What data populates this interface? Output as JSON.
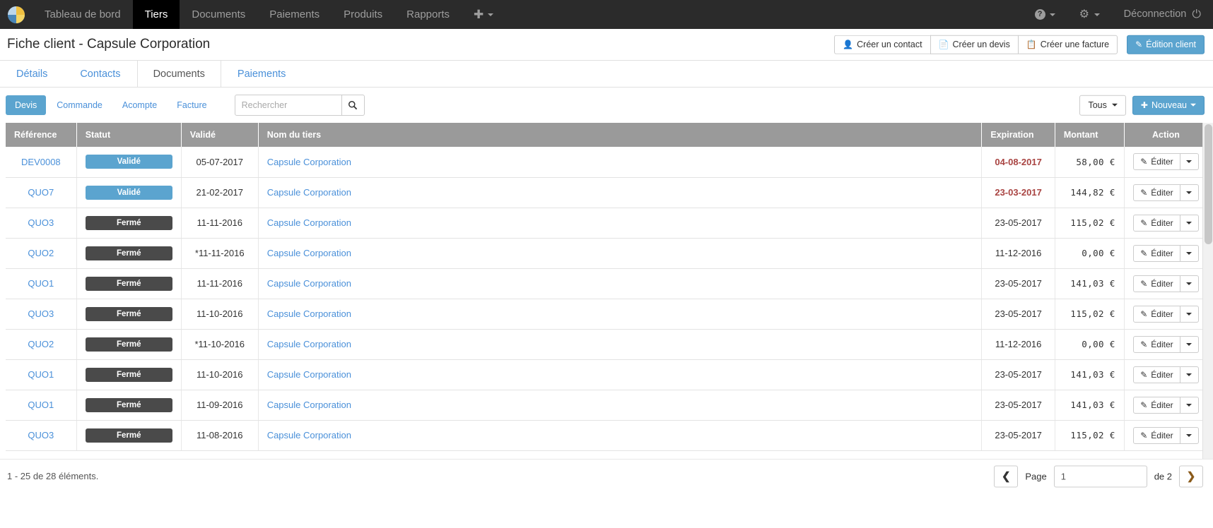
{
  "navbar": {
    "logo_icon": "pie-chart-logo",
    "items": [
      {
        "label": "Tableau de bord",
        "active": false
      },
      {
        "label": "Tiers",
        "active": true
      },
      {
        "label": "Documents",
        "active": false
      },
      {
        "label": "Paiements",
        "active": false
      },
      {
        "label": "Produits",
        "active": false
      },
      {
        "label": "Rapports",
        "active": false
      }
    ],
    "add_icon": "plus-icon",
    "help_icon": "question-circle-icon",
    "settings_icon": "gear-icon",
    "logout_label": "Déconnection",
    "power_icon": "power-icon"
  },
  "header": {
    "title": "Fiche client - Capsule Corporation",
    "actions": [
      {
        "label": "Créer un contact",
        "icon": "user-icon"
      },
      {
        "label": "Créer un devis",
        "icon": "file-icon"
      },
      {
        "label": "Créer une facture",
        "icon": "invoice-icon"
      }
    ],
    "primary_action": {
      "label": "Édition client",
      "icon": "pencil-square-icon",
      "color": "#5ba4cf"
    }
  },
  "tabs": [
    {
      "label": "Détails",
      "active": false
    },
    {
      "label": "Contacts",
      "active": false
    },
    {
      "label": "Documents",
      "active": true
    },
    {
      "label": "Paiements",
      "active": false
    }
  ],
  "filterbar": {
    "pills": [
      {
        "label": "Devis",
        "active": true
      },
      {
        "label": "Commande",
        "active": false
      },
      {
        "label": "Acompte",
        "active": false
      },
      {
        "label": "Facture",
        "active": false
      }
    ],
    "search": {
      "value": "",
      "placeholder": "Rechercher",
      "icon": "search-icon"
    },
    "filter_dropdown": {
      "label": "Tous",
      "icon": "chevron-down-icon"
    },
    "new_button": {
      "label": "Nouveau",
      "icon": "plus-icon",
      "color": "#5ba4cf"
    }
  },
  "table": {
    "columns": [
      "Référence",
      "Statut",
      "Validé",
      "Nom du tiers",
      "Expiration",
      "Montant",
      "Action"
    ],
    "action_label": "Éditer",
    "action_icon": "pencil-icon",
    "rows": [
      {
        "ref": "DEV0008",
        "statut": "Validé",
        "statut_kind": "valide",
        "valide": "05-07-2017",
        "nom": "Capsule Corporation",
        "expiration": "04-08-2017",
        "expiration_late": true,
        "montant": "58,00 €"
      },
      {
        "ref": "QUO7",
        "statut": "Validé",
        "statut_kind": "valide",
        "valide": "21-02-2017",
        "nom": "Capsule Corporation",
        "expiration": "23-03-2017",
        "expiration_late": true,
        "montant": "144,82 €"
      },
      {
        "ref": "QUO3",
        "statut": "Fermé",
        "statut_kind": "ferme",
        "valide": "11-11-2016",
        "nom": "Capsule Corporation",
        "expiration": "23-05-2017",
        "expiration_late": false,
        "montant": "115,02 €"
      },
      {
        "ref": "QUO2",
        "statut": "Fermé",
        "statut_kind": "ferme",
        "valide": "*11-11-2016",
        "nom": "Capsule Corporation",
        "expiration": "11-12-2016",
        "expiration_late": false,
        "montant": "0,00 €"
      },
      {
        "ref": "QUO1",
        "statut": "Fermé",
        "statut_kind": "ferme",
        "valide": "11-11-2016",
        "nom": "Capsule Corporation",
        "expiration": "23-05-2017",
        "expiration_late": false,
        "montant": "141,03 €"
      },
      {
        "ref": "QUO3",
        "statut": "Fermé",
        "statut_kind": "ferme",
        "valide": "11-10-2016",
        "nom": "Capsule Corporation",
        "expiration": "23-05-2017",
        "expiration_late": false,
        "montant": "115,02 €"
      },
      {
        "ref": "QUO2",
        "statut": "Fermé",
        "statut_kind": "ferme",
        "valide": "*11-10-2016",
        "nom": "Capsule Corporation",
        "expiration": "11-12-2016",
        "expiration_late": false,
        "montant": "0,00 €"
      },
      {
        "ref": "QUO1",
        "statut": "Fermé",
        "statut_kind": "ferme",
        "valide": "11-10-2016",
        "nom": "Capsule Corporation",
        "expiration": "23-05-2017",
        "expiration_late": false,
        "montant": "141,03 €"
      },
      {
        "ref": "QUO1",
        "statut": "Fermé",
        "statut_kind": "ferme",
        "valide": "11-09-2016",
        "nom": "Capsule Corporation",
        "expiration": "23-05-2017",
        "expiration_late": false,
        "montant": "141,03 €"
      },
      {
        "ref": "QUO3",
        "statut": "Fermé",
        "statut_kind": "ferme",
        "valide": "11-08-2016",
        "nom": "Capsule Corporation",
        "expiration": "23-05-2017",
        "expiration_late": false,
        "montant": "115,02 €"
      }
    ]
  },
  "footer": {
    "count_text": "1 - 25 de 28 éléments.",
    "prev_icon": "chevron-left-icon",
    "next_icon": "chevron-right-icon",
    "page_label": "Page",
    "page_value": "1",
    "of_label": "de 2"
  }
}
